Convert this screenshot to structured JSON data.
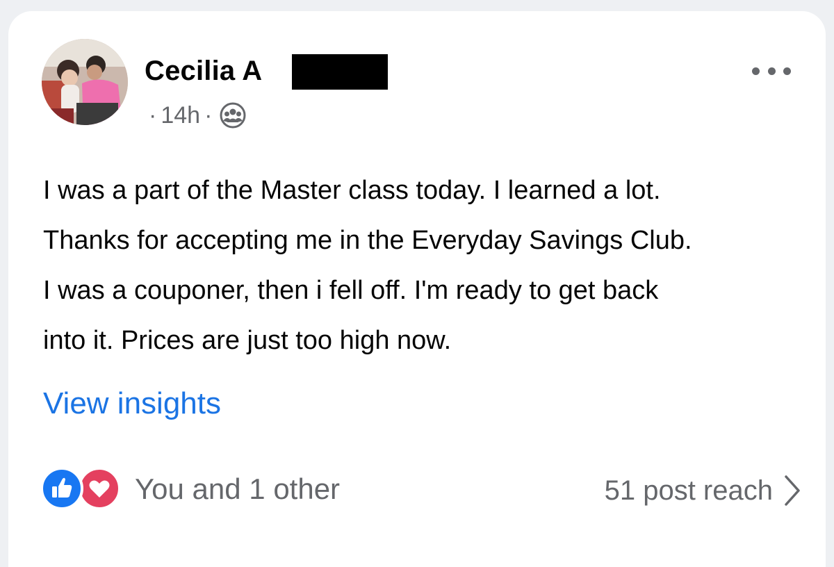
{
  "post": {
    "author": "Cecilia A",
    "author_redacted": true,
    "meta": {
      "separator_1": "·",
      "time": "14h",
      "separator_2": "·",
      "audience_icon": "group-icon"
    },
    "more_icon": "more-options-icon",
    "text_lines": [
      "I was a part of the Master class today. I learned a lot.",
      "Thanks for accepting me in the Everyday Savings Club.",
      "I was a couponer, then i fell off. I'm ready to get back",
      "into it. Prices are just too high now."
    ],
    "view_insights": "View insights",
    "reactions": {
      "icons": [
        "like-icon",
        "love-icon"
      ],
      "text": "You and 1 other"
    },
    "reach": {
      "text": "51 post reach",
      "icon": "chevron-right-icon"
    }
  },
  "colors": {
    "background": "#eef0f3",
    "card": "#ffffff",
    "link": "#1b74e4",
    "secondary_text": "#65676b",
    "like": "#1877f2",
    "love": "#e4405f"
  }
}
